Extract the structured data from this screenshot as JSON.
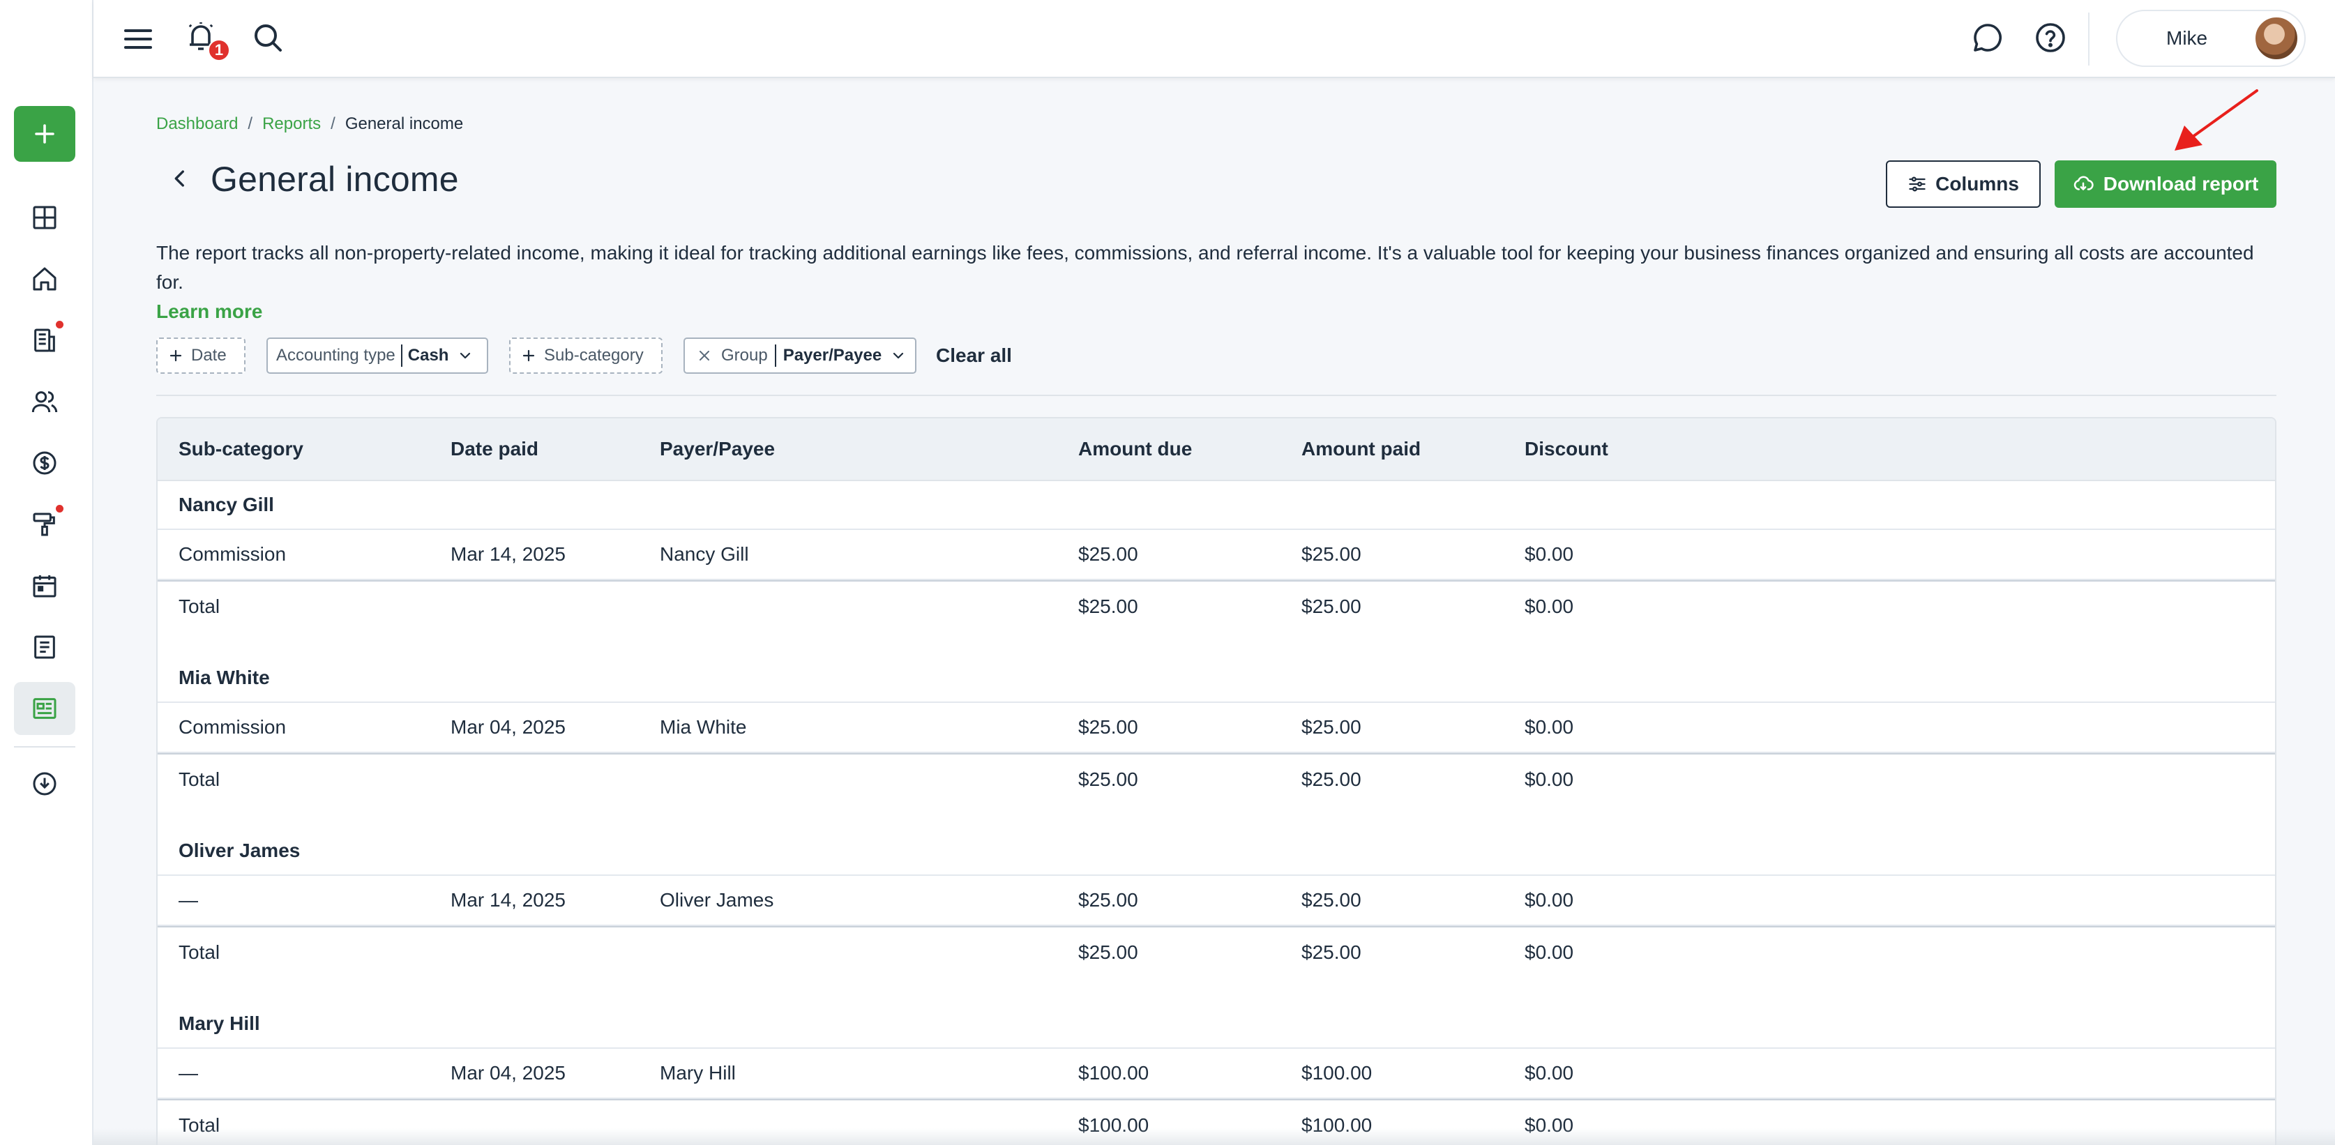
{
  "topbar": {
    "notification_count": "1",
    "user_name": "Mike"
  },
  "breadcrumb": {
    "items": [
      "Dashboard",
      "Reports"
    ],
    "current": "General income",
    "separator": "/"
  },
  "page": {
    "title": "General income",
    "description": "The report tracks all non-property-related income, making it ideal for tracking additional earnings like fees, commissions, and referral income. It's a valuable tool for keeping your business finances organized and ensuring all costs are accounted for.",
    "learn_more": "Learn more",
    "columns_label": "Columns",
    "download_label": "Download report"
  },
  "filters": {
    "date": "Date",
    "accounting_type_label": "Accounting type",
    "accounting_type_value": "Cash",
    "subcategory": "Sub-category",
    "group_label": "Group",
    "group_value": "Payer/Payee",
    "clear_all": "Clear all"
  },
  "table": {
    "headers": [
      "Sub-category",
      "Date paid",
      "Payer/Payee",
      "Amount due",
      "Amount paid",
      "Discount"
    ],
    "groups": [
      {
        "name": "Nancy Gill",
        "row": [
          "Commission",
          "Mar 14, 2025",
          "Nancy Gill",
          "$25.00",
          "$25.00",
          "$0.00"
        ],
        "total": [
          "Total",
          "$25.00",
          "$25.00",
          "$0.00"
        ]
      },
      {
        "name": "Mia White",
        "row": [
          "Commission",
          "Mar 04, 2025",
          "Mia White",
          "$25.00",
          "$25.00",
          "$0.00"
        ],
        "total": [
          "Total",
          "$25.00",
          "$25.00",
          "$0.00"
        ]
      },
      {
        "name": "Oliver James",
        "row": [
          "—",
          "Mar 14, 2025",
          "Oliver James",
          "$25.00",
          "$25.00",
          "$0.00"
        ],
        "total": [
          "Total",
          "$25.00",
          "$25.00",
          "$0.00"
        ]
      },
      {
        "name": "Mary Hill",
        "row": [
          "—",
          "Mar 04, 2025",
          "Mary Hill",
          "$100.00",
          "$100.00",
          "$0.00"
        ],
        "total": [
          "Total",
          "$100.00",
          "$100.00",
          "$0.00"
        ]
      }
    ]
  },
  "colors": {
    "brand_green": "#3aa346",
    "text_dark": "#1f2d3d",
    "alert_red": "#e0312d",
    "annotation_red": "#e8201c"
  }
}
